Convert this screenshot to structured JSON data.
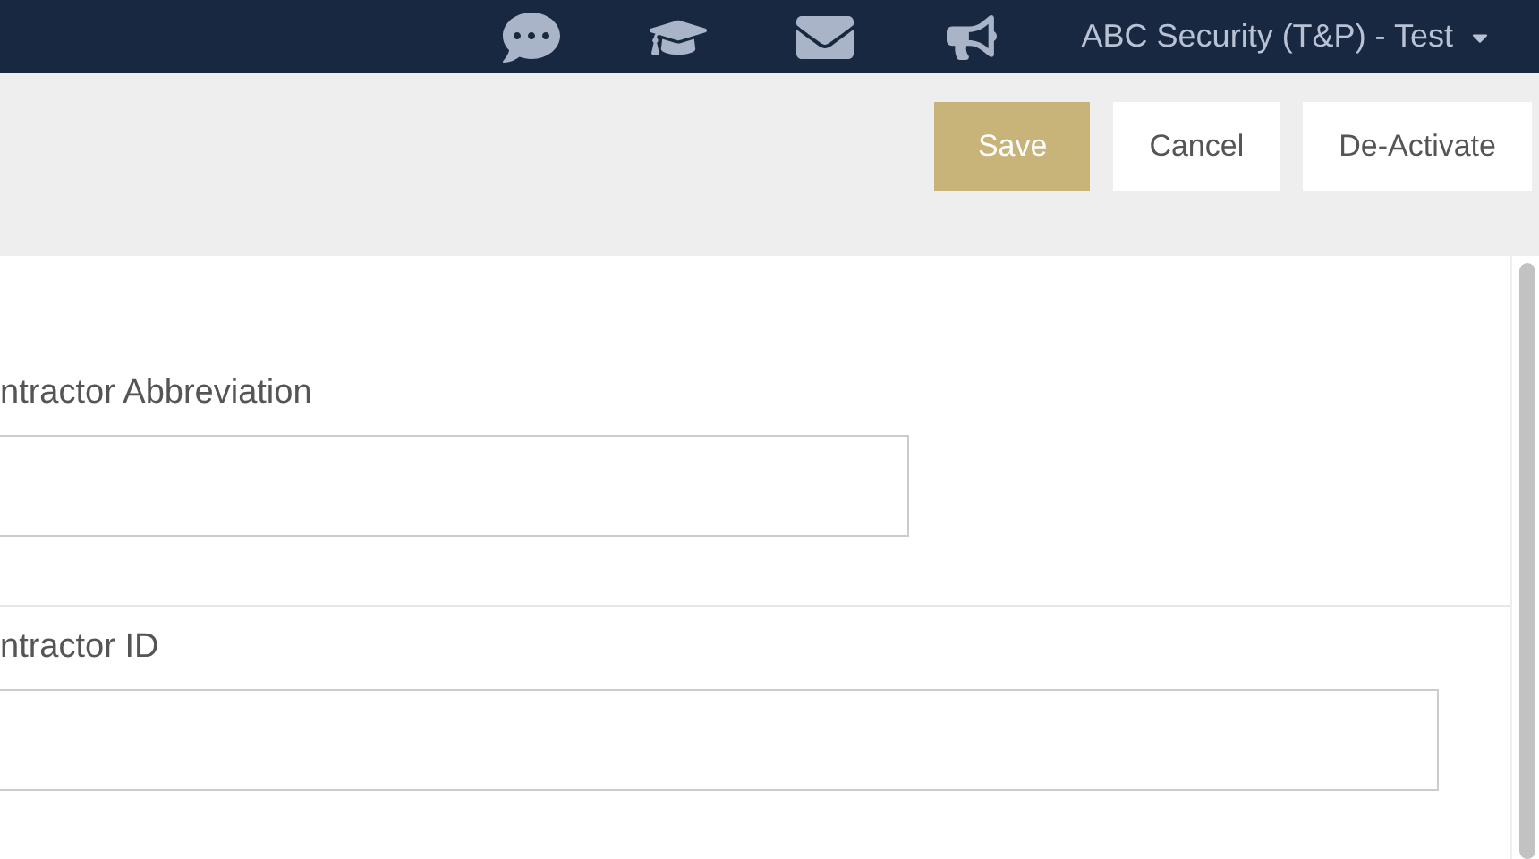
{
  "header": {
    "account": "ABC Security (T&P) - Test"
  },
  "actions": [
    {
      "label": "Save",
      "kind": "primary"
    },
    {
      "label": "Cancel",
      "kind": "default"
    },
    {
      "label": "De-Activate",
      "kind": "default"
    }
  ],
  "form": {
    "fields": [
      {
        "label": "ntractor Abbreviation",
        "kind": "short"
      },
      {
        "label": "ntractor ID",
        "kind": "wide"
      }
    ]
  }
}
